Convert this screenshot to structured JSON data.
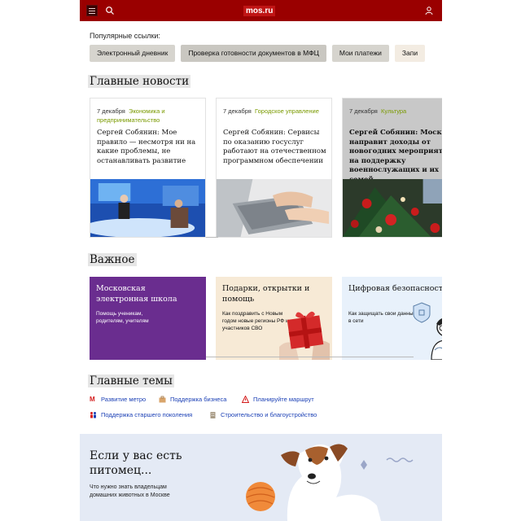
{
  "header": {
    "logo": "mos.ru",
    "icons": [
      "menu-icon",
      "search-icon",
      "user-icon"
    ]
  },
  "popular": {
    "title": "Популярные ссылки:",
    "links": [
      "Электронный дневник",
      "Проверка готовности документов в МФЦ",
      "Мои платежи",
      "Запи"
    ]
  },
  "news": {
    "heading": "Главные новости",
    "cards": [
      {
        "date": "7 декабря",
        "category": "Экономика и предпринимательство",
        "title": "Сергей Собянин: Мое правило — несмотря ни на какие проблемы, не останавливать развитие"
      },
      {
        "date": "7 декабря",
        "category": "Городское управление",
        "title": "Сергей Собянин: Сервисы по оказанию госуслуг работают на отечественном программном обеспечении"
      },
      {
        "date": "7 декабря",
        "category": "Культура",
        "title": "Сергей Собянин: Москва направит доходы от новогодних мероприятий на поддержку военнослужащих и их семей"
      }
    ]
  },
  "important": {
    "heading": "Важное",
    "cards": [
      {
        "title": "Московская электронная школа",
        "subtitle": "Помощь ученикам, родителям, учителям"
      },
      {
        "title": "Подарки, открытки и помощь",
        "subtitle": "Как поздравить с Новым годом новые регионы РФ и участников СВО"
      },
      {
        "title": "Цифровая безопасность",
        "subtitle": "Как защищать свои данные в сети"
      }
    ]
  },
  "themes": {
    "heading": "Главные темы",
    "items": [
      {
        "label": "Развитие метро",
        "icon": "metro-icon"
      },
      {
        "label": "Поддержка бизнеса",
        "icon": "briefcase-icon"
      },
      {
        "label": "Планируйте маршрут",
        "icon": "warning-icon"
      },
      {
        "label": "Поддержка старшего поколения",
        "icon": "people-icon"
      },
      {
        "label": "Строительство и благоустройство",
        "icon": "building-icon"
      }
    ]
  },
  "banner": {
    "title": "Если у вас есть питомец...",
    "subtitle": "Что нужно знать владельцам домашних животных в Москве"
  },
  "colors": {
    "header": "#9a0000",
    "logo_bg": "#c01515",
    "link": "#1a3fb5",
    "category": "#7a9a00",
    "school_card": "#6a2d8f",
    "gifts_card": "#f7ead6",
    "security_card": "#e8f1fb",
    "banner_bg": "#e4eaf5"
  }
}
